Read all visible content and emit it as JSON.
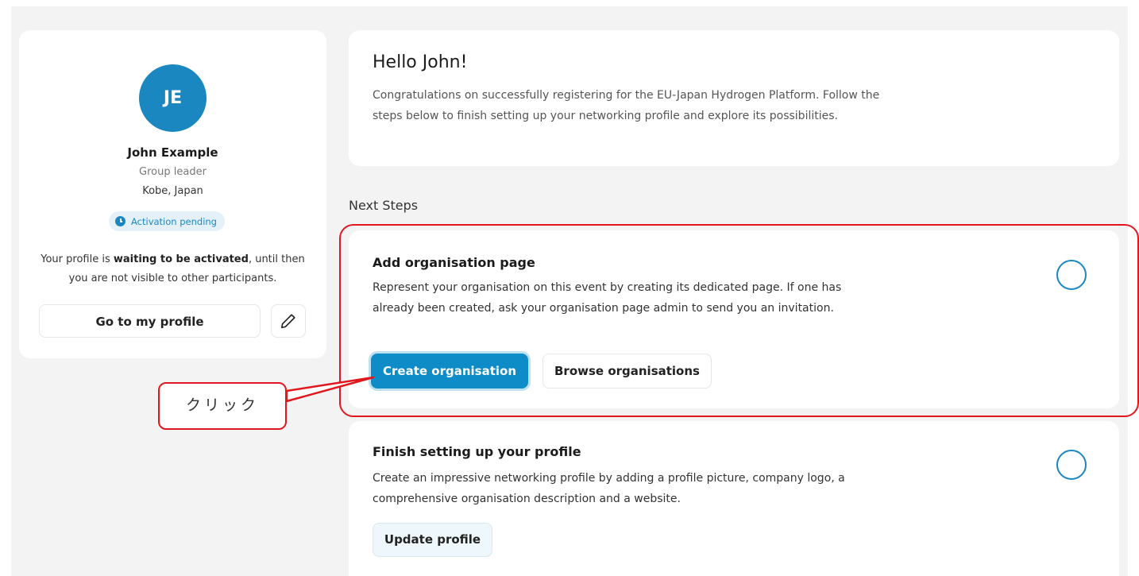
{
  "profile": {
    "initials": "JE",
    "name": "John Example",
    "role": "Group leader",
    "location": "Kobe, Japan",
    "status_badge": "Activation pending",
    "message_before": "Your profile is ",
    "message_bold": "waiting to be activated",
    "message_after": ", until then you are not visible to other participants.",
    "go_to_profile_label": "Go to my profile",
    "edit_icon": "pencil-icon"
  },
  "greeting": {
    "title": "Hello John!",
    "text": "Congratulations on successfully registering for the EU-Japan Hydrogen Platform. Follow the steps below to finish setting up your networking profile and explore its possibilities."
  },
  "next_steps": {
    "heading": "Next Steps",
    "items": [
      {
        "title": "Add organisation page",
        "text": "Represent your organisation on this event by creating its dedicated page. If one has already been created, ask your organisation page admin to send you an invitation.",
        "primary_label": "Create organisation",
        "secondary_label": "Browse organisations",
        "completed": false
      },
      {
        "title": "Finish setting up your profile",
        "text": "Create an impressive networking profile by adding a profile picture, company logo, a comprehensive organisation description and a website.",
        "button_label": "Update profile",
        "completed": false
      }
    ]
  },
  "annotation": {
    "callout_text": "クリック",
    "color": "#e0171f"
  },
  "colors": {
    "accent": "#1a87c1",
    "primary_button": "#0d8cc7",
    "background": "#f3f3f3"
  }
}
